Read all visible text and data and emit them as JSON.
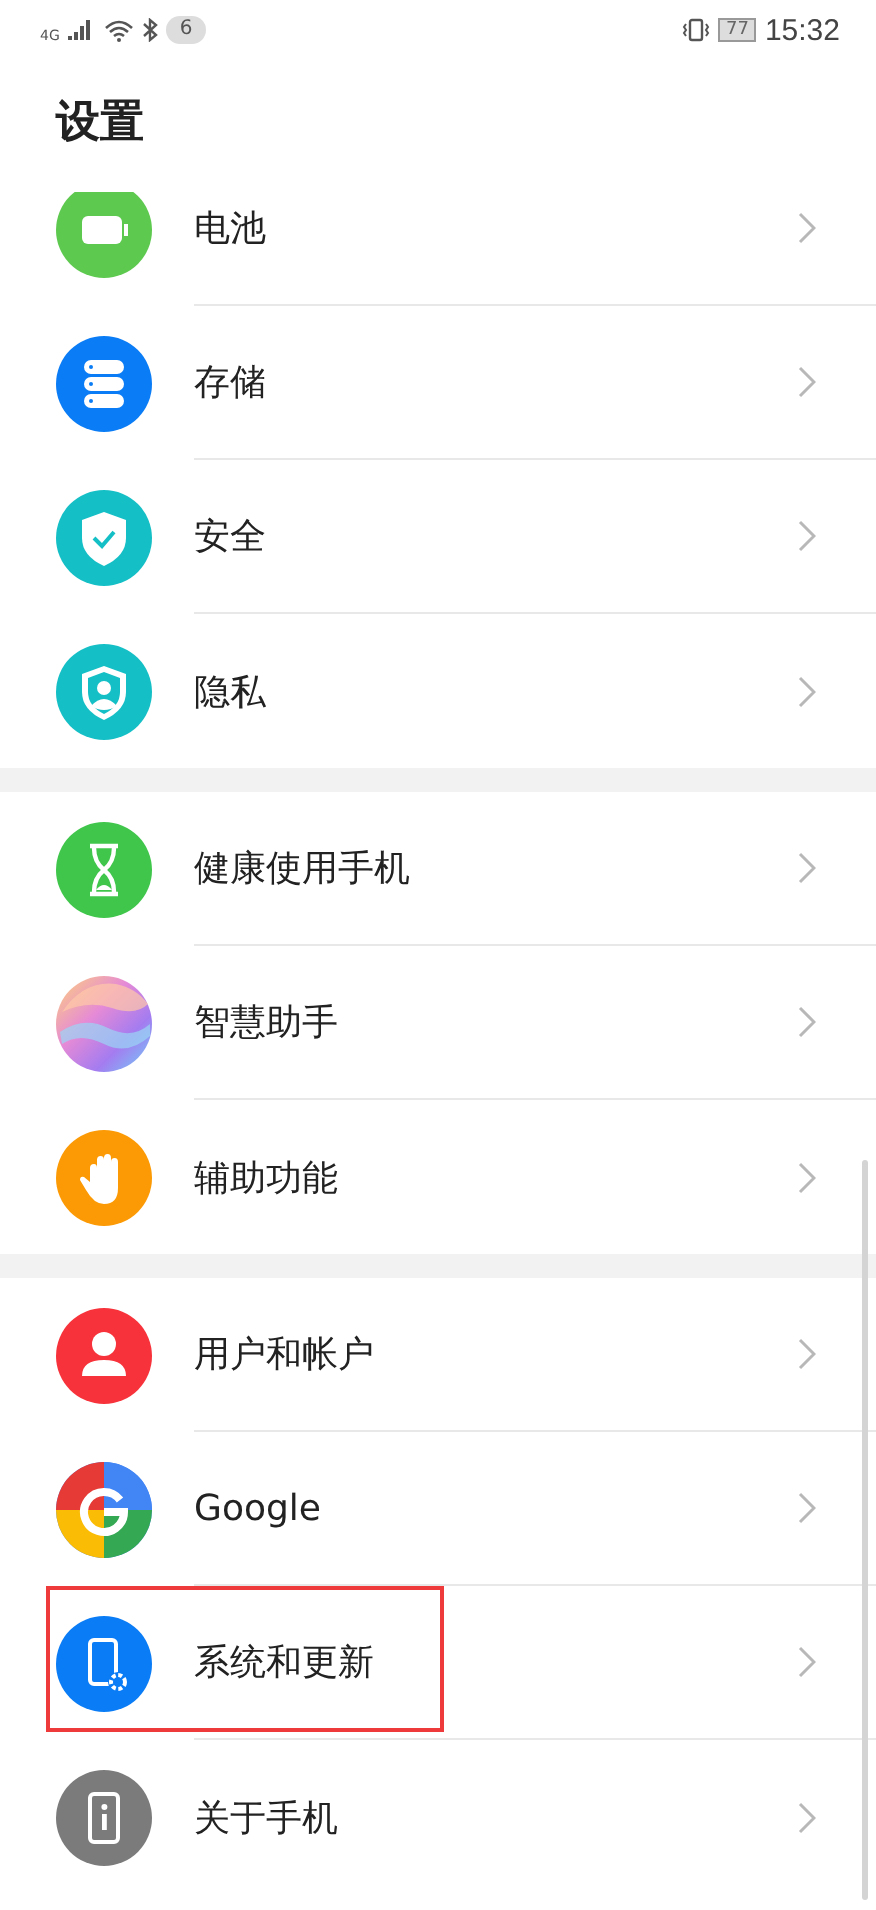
{
  "status_bar": {
    "network": "4G",
    "notification_count": "6",
    "battery": "77",
    "time": "15:32"
  },
  "title": "设置",
  "groups": [
    {
      "items": [
        {
          "label": "电池",
          "kind": "battery",
          "color": "#5ec94f",
          "highlighted": false
        },
        {
          "label": "存储",
          "kind": "storage",
          "color": "#0a7cf5",
          "highlighted": false
        },
        {
          "label": "安全",
          "kind": "shield",
          "color": "#15bfc6",
          "highlighted": false
        },
        {
          "label": "隐私",
          "kind": "privacy",
          "color": "#15bfc6",
          "highlighted": false
        }
      ]
    },
    {
      "items": [
        {
          "label": "健康使用手机",
          "kind": "hourglass",
          "color": "#3fc64b",
          "highlighted": false
        },
        {
          "label": "智慧助手",
          "kind": "orb",
          "color": "#e58ad6",
          "highlighted": false
        },
        {
          "label": "辅助功能",
          "kind": "hand",
          "color": "#fb9a05",
          "highlighted": false
        }
      ]
    },
    {
      "items": [
        {
          "label": "用户和帐户",
          "kind": "user",
          "color": "#f7323a",
          "highlighted": false
        },
        {
          "label": "Google",
          "kind": "google",
          "color": "#4285f4",
          "highlighted": false
        },
        {
          "label": "系统和更新",
          "kind": "system",
          "color": "#0a7cf5",
          "highlighted": true
        },
        {
          "label": "关于手机",
          "kind": "about",
          "color": "#7b7b7b",
          "highlighted": false
        }
      ]
    }
  ]
}
